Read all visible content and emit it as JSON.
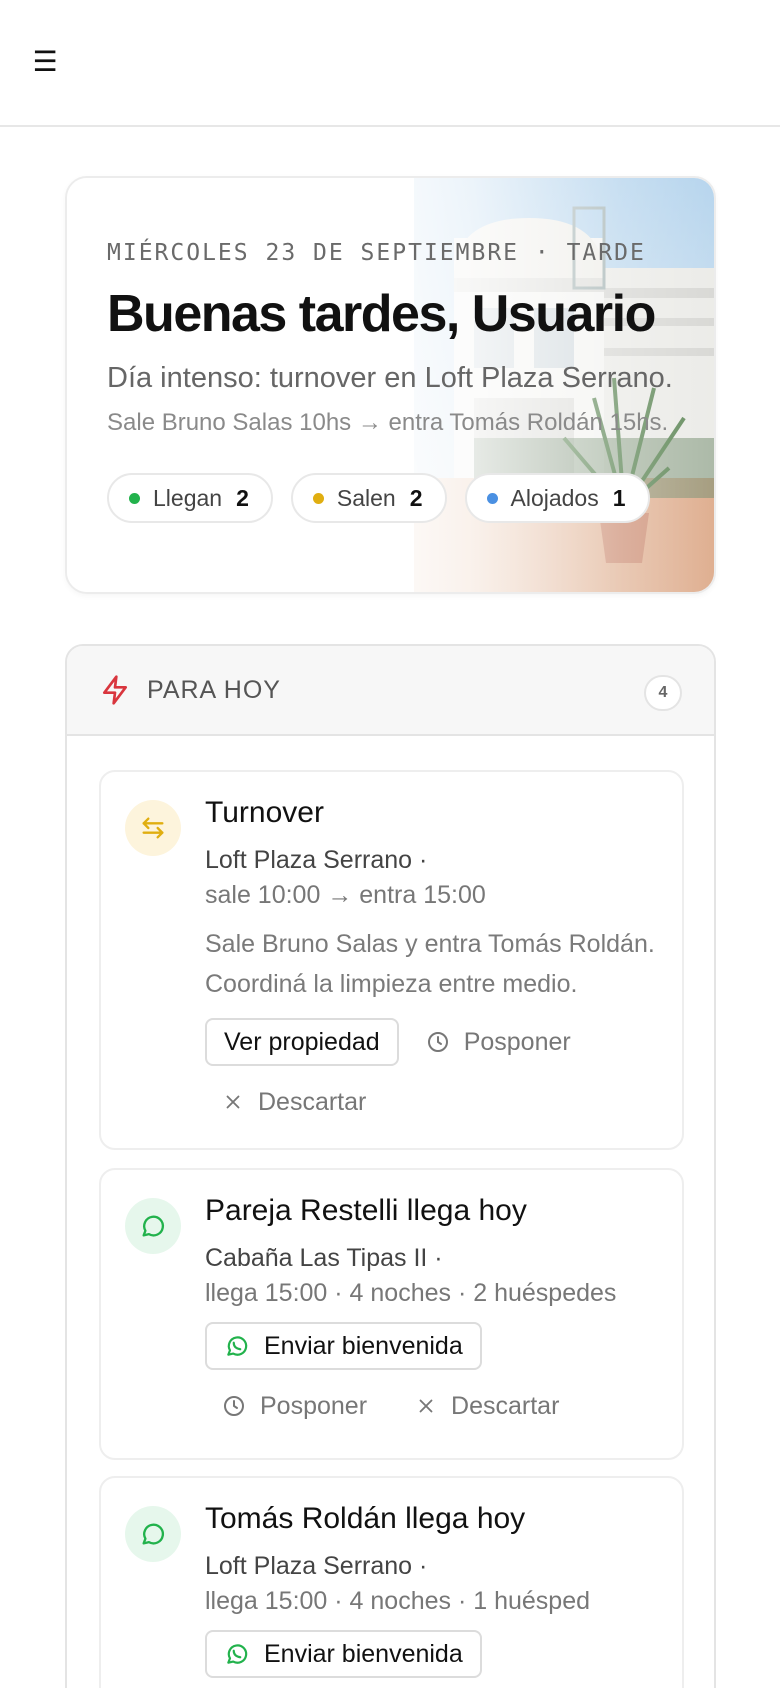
{
  "header": {
    "menu_icon": "hamburger-menu-icon",
    "menu_glyph": "☰"
  },
  "hero": {
    "date": "MIÉRCOLES 23 DE SEPTIEMBRE · TARDE",
    "greeting": "Buenas tardes, Usuario",
    "summary": "Día intenso: turnover en Loft Plaza Serrano.",
    "detail": "Sale Bruno Salas 10hs → entra Tomás Roldán 15hs.",
    "stats": [
      {
        "label": "Llegan",
        "count": "2",
        "color": "#22b24c"
      },
      {
        "label": "Salen",
        "count": "2",
        "color": "#e0ae10"
      },
      {
        "label": "Alojados",
        "count": "1",
        "color": "#4a90e2"
      }
    ]
  },
  "today": {
    "title": "PARA HOY",
    "count": "4",
    "icon": "lightning-icon",
    "accent": "#d9363e",
    "tasks": [
      {
        "icon": "swap-arrows-icon",
        "title": "Turnover",
        "property": "Loft Plaza Serrano ·",
        "meta": "sale 10:00 → entra 15:00",
        "description": "Sale Bruno Salas y entra Tomás Roldán. Coordiná la limpieza entre medio.",
        "primary_action": "Ver propiedad",
        "postpone": "Posponer",
        "dismiss": "Descartar"
      },
      {
        "icon": "whatsapp-icon",
        "title": "Pareja Restelli llega hoy",
        "property": "Cabaña Las Tipas II ·",
        "meta": "llega 15:00 · 4 noches · 2 huéspedes",
        "primary_action": "Enviar bienvenida",
        "postpone": "Posponer",
        "dismiss": "Descartar"
      },
      {
        "icon": "whatsapp-icon",
        "title": "Tomás Roldán llega hoy",
        "property": "Loft Plaza Serrano ·",
        "meta": "llega 15:00 · 4 noches · 1 huésped",
        "primary_action": "Enviar bienvenida"
      }
    ]
  },
  "colors": {
    "turnover_bg": "#fdf4dc",
    "turnover_fg": "#e0ae10",
    "whatsapp_bg": "#e6f7ec",
    "whatsapp_fg": "#22b24c"
  }
}
